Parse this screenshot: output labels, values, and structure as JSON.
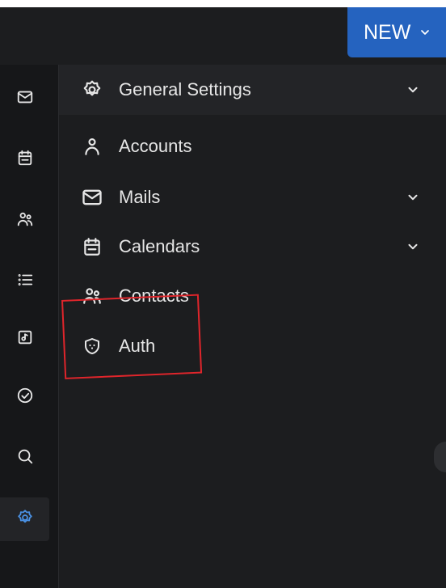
{
  "colors": {
    "accent": "#2563bf",
    "active_icon": "#4a90e2",
    "highlight": "#e0252b",
    "text": "#e6e6e6"
  },
  "toolbar": {
    "new_label": "NEW",
    "new_icon": "chevron-down-icon"
  },
  "rail": {
    "items": [
      {
        "icon": "mail-icon"
      },
      {
        "icon": "calendar-icon"
      },
      {
        "icon": "contacts-icon"
      },
      {
        "icon": "list-icon"
      },
      {
        "icon": "files-icon"
      },
      {
        "icon": "check-circle-icon"
      },
      {
        "icon": "search-icon"
      },
      {
        "icon": "settings-icon",
        "active": true
      }
    ]
  },
  "nav": {
    "items": [
      {
        "label": "General Settings",
        "icon": "settings-icon",
        "expandable": true,
        "active": true
      },
      {
        "label": "Accounts",
        "icon": "user-icon",
        "expandable": false
      },
      {
        "label": "Mails",
        "icon": "mail-icon",
        "expandable": true
      },
      {
        "label": "Calendars",
        "icon": "calendar-icon",
        "expandable": true
      },
      {
        "label": "Contacts",
        "icon": "contacts-icon",
        "expandable": false
      },
      {
        "label": "Auth",
        "icon": "shield-icon",
        "expandable": false,
        "highlighted": true
      }
    ]
  }
}
